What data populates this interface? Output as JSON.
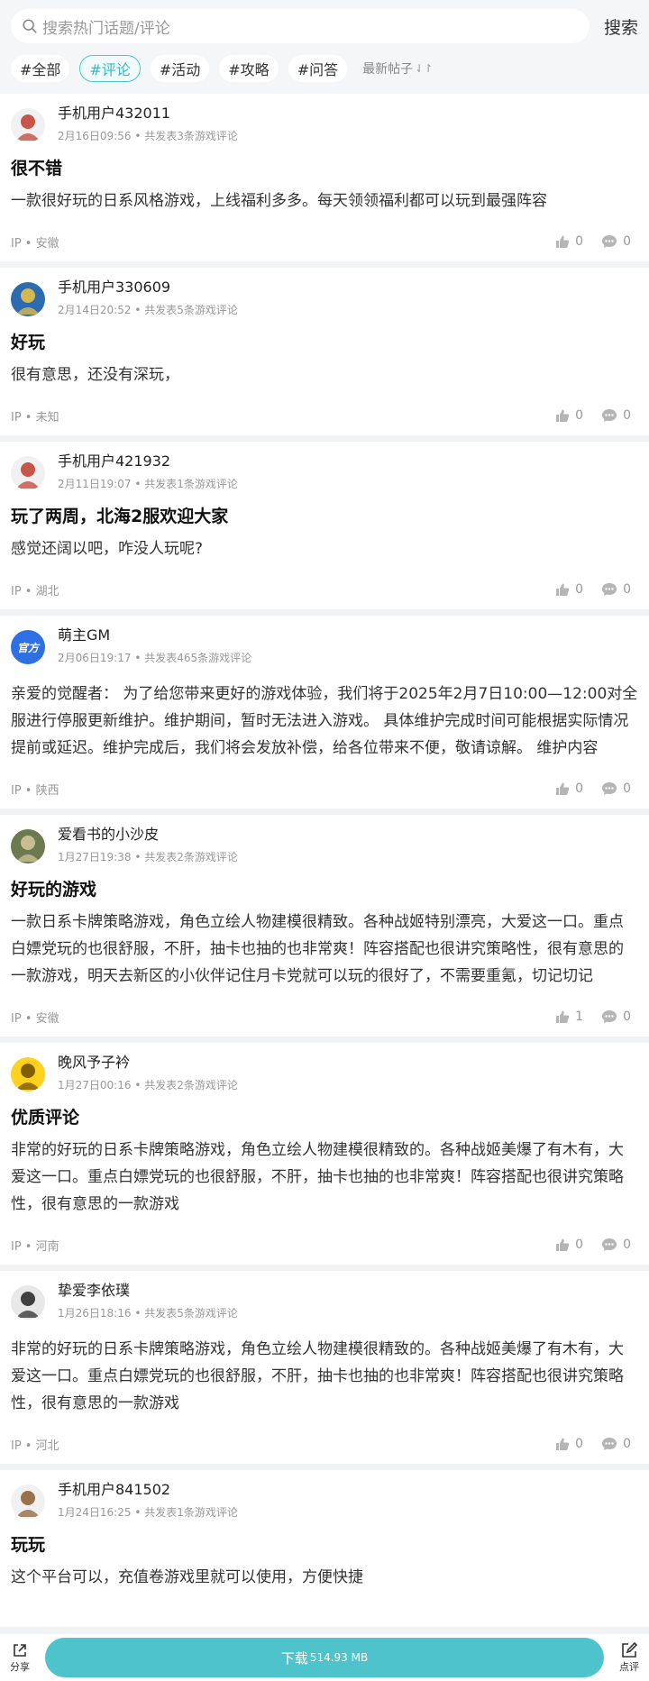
{
  "search": {
    "placeholder": "搜索热门话题/评论",
    "button": "搜索"
  },
  "filters": [
    {
      "label": "#全部",
      "active": false
    },
    {
      "label": "#评论",
      "active": true
    },
    {
      "label": "#活动",
      "active": false
    },
    {
      "label": "#攻略",
      "active": false
    },
    {
      "label": "#问答",
      "active": false
    }
  ],
  "sort": {
    "label": "最新帖子",
    "icon": "sort-arrows-icon"
  },
  "posts": [
    {
      "username": "手机用户432011",
      "date": "2月16日09:56",
      "count": "共发表3条游戏评论",
      "title": "很不错",
      "body": "一款很好玩的日系风格游戏，上线福利多多。每天领领福利都可以玩到最强阵容",
      "ip": "IP • 安徽",
      "likes": "0",
      "comments": "0"
    },
    {
      "username": "手机用户330609",
      "date": "2月14日20:52",
      "count": "共发表5条游戏评论",
      "title": "好玩",
      "body": "很有意思，还没有深玩，",
      "ip": "IP • 未知",
      "likes": "0",
      "comments": "0"
    },
    {
      "username": "手机用户421932",
      "date": "2月11日19:07",
      "count": "共发表1条游戏评论",
      "title": "玩了两周，北海2服欢迎大家",
      "body": "感觉还阔以吧，咋没人玩呢?",
      "ip": "IP • 湖北",
      "likes": "0",
      "comments": "0"
    },
    {
      "username": "萌主GM",
      "date": "2月06日19:17",
      "count": "共发表465条游戏评论",
      "title": "",
      "body": "亲爱的觉醒者：  为了给您带来更好的游戏体验，我们将于2025年2月7日10:00—12:00对全服进行停服更新维护。维护期间，暂时无法进入游戏。 具体维护完成时间可能根据实际情况提前或延迟。维护完成后，我们将会发放补偿，给各位带来不便，敬请谅解。 维护内容",
      "ip": "IP • 陕西",
      "likes": "0",
      "comments": "0",
      "avatar_label": "官方"
    },
    {
      "username": "爱看书的小沙皮",
      "date": "1月27日19:38",
      "count": "共发表2条游戏评论",
      "title": "好玩的游戏",
      "body": "一款日系卡牌策略游戏，角色立绘人物建模很精致。各种战姬特别漂亮，大爱这一口。重点白嫖党玩的也很舒服，不肝，抽卡也抽的也非常爽！阵容搭配也很讲究策略性，很有意思的一款游戏，明天去新区的小伙伴记住月卡党就可以玩的很好了，不需要重氪，切记切记",
      "ip": "IP • 安徽",
      "likes": "1",
      "comments": "0"
    },
    {
      "username": "晚风予子衿",
      "date": "1月27日00:16",
      "count": "共发表2条游戏评论",
      "title": "优质评论",
      "body": "非常的好玩的日系卡牌策略游戏，角色立绘人物建模很精致的。各种战姬美爆了有木有，大爱这一口。重点白嫖党玩的也很舒服，不肝，抽卡也抽的也非常爽！阵容搭配也很讲究策略性，很有意思的一款游戏",
      "ip": "IP • 河南",
      "likes": "0",
      "comments": "0"
    },
    {
      "username": "挚爱李依璞",
      "date": "1月26日18:16",
      "count": "共发表5条游戏评论",
      "title": "",
      "body": "非常的好玩的日系卡牌策略游戏，角色立绘人物建模很精致的。各种战姬美爆了有木有，大爱这一口。重点白嫖党玩的也很舒服，不肝，抽卡也抽的也非常爽！阵容搭配也很讲究策略性，很有意思的一款游戏",
      "ip": "IP • 河北",
      "likes": "0",
      "comments": "0"
    },
    {
      "username": "手机用户841502",
      "date": "1月24日16:25",
      "count": "共发表1条游戏评论",
      "title": "玩玩",
      "body": "这个平台可以，充值卷游戏里就可以使用，方便快捷",
      "ip": "",
      "likes": "",
      "comments": ""
    }
  ],
  "bottom": {
    "share": "分享",
    "download": "下载",
    "size": "514.93 MB",
    "review": "点评"
  },
  "colors": {
    "accent": "#4fc3cc"
  }
}
